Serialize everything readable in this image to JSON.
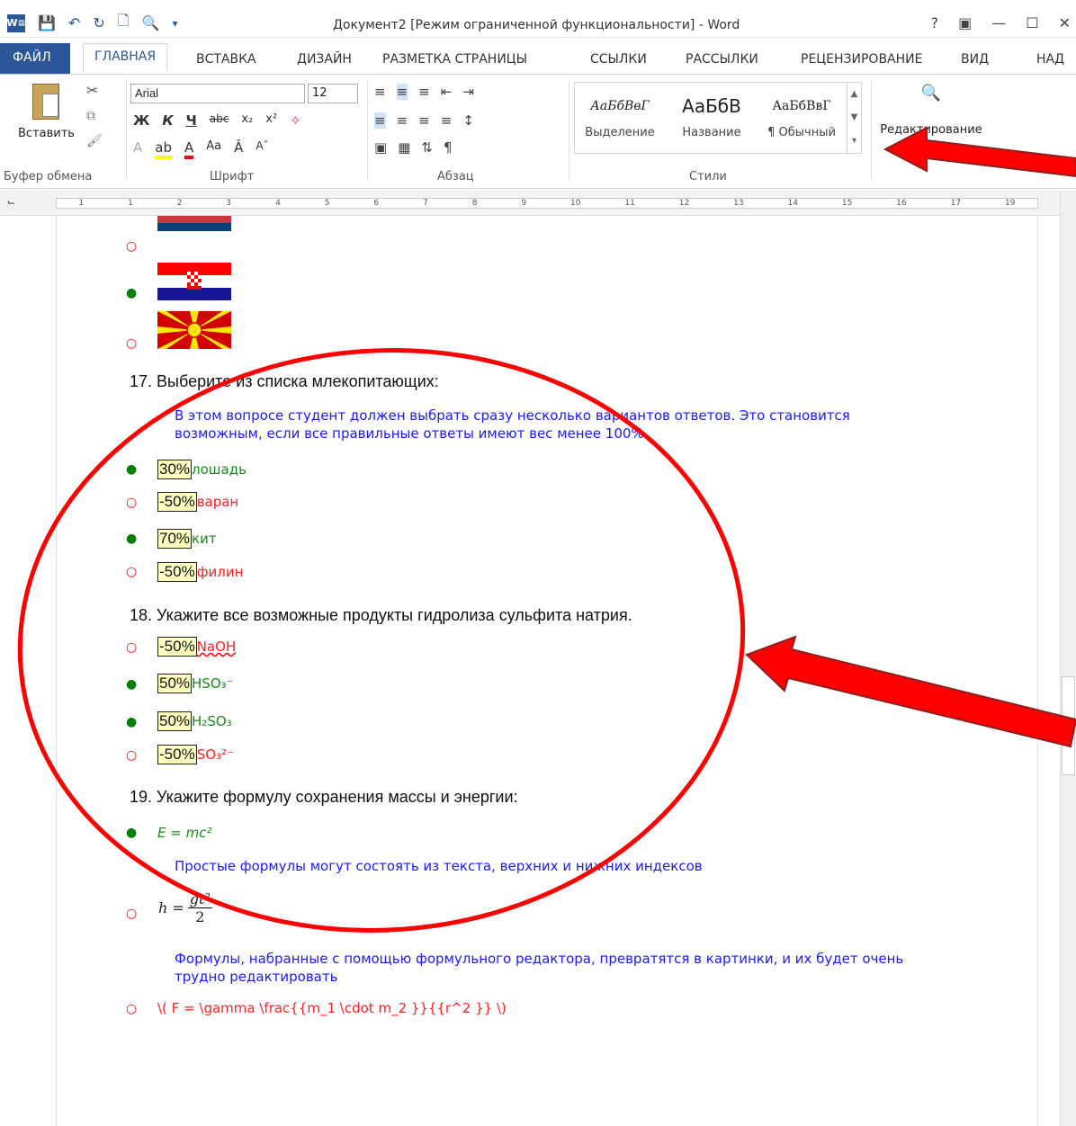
{
  "window": {
    "title": "Документ2 [Режим ограниченной функциональности] - Word",
    "help": "?",
    "minimize": "—",
    "maximize": "☐",
    "close": "✕",
    "word_logo": "W≡"
  },
  "tabs": {
    "file": "ФАЙЛ",
    "home": "ГЛАВНАЯ",
    "insert": "ВСТАВКА",
    "design": "ДИЗАЙН",
    "layout": "РАЗМЕТКА СТРАНИЦЫ",
    "references": "ССЫЛКИ",
    "mailings": "РАССЫЛКИ",
    "review": "РЕЦЕНЗИРОВАНИЕ",
    "view": "ВИД",
    "addins": "НАД"
  },
  "ribbon": {
    "paste_label": "Вставить",
    "clipboard_group": "Буфер обмена",
    "font_group": "Шрифт",
    "paragraph_group": "Абзац",
    "styles_group": "Стили",
    "font_name": "Arial",
    "font_size": "12",
    "styles": [
      {
        "preview": "АаБбВвГ",
        "name": "Выделение"
      },
      {
        "preview": "АаБбВ",
        "name": "Название"
      },
      {
        "preview": "АаБбВвГ",
        "name": "¶ Обычный"
      }
    ],
    "editing_label": "Редактирование"
  },
  "ruler": {
    "ticks": [
      "1",
      "1",
      "2",
      "3",
      "4",
      "5",
      "6",
      "7",
      "8",
      "9",
      "10",
      "11",
      "12",
      "13",
      "14",
      "15",
      "16",
      "17",
      "19"
    ]
  },
  "document": {
    "q17": {
      "question": "17. Выберите из списка млекопитающих:",
      "note": "В этом вопросе студент должен выбрать сразу несколько вариантов ответов. Это становится возможным, если все правильные ответы имеют вес менее 100%",
      "answers": [
        {
          "pct": "30%",
          "text": "лошадь"
        },
        {
          "pct": "-50%",
          "text": "варан"
        },
        {
          "pct": "70%",
          "text": "кит"
        },
        {
          "pct": "-50%",
          "text": "филин"
        }
      ]
    },
    "q18": {
      "question": "18. Укажите все возможные продукты гидролиза сульфита натрия.",
      "answers": [
        {
          "pct": "-50%",
          "text": "NaOH"
        },
        {
          "pct": "50%",
          "text": "HSO₃⁻"
        },
        {
          "pct": "50%",
          "text": "H₂SO₃"
        },
        {
          "pct": "-50%",
          "text": "SO₃²⁻"
        }
      ]
    },
    "q19": {
      "question": "19. Укажите формулу сохранения массы и энергии:",
      "answer1": "E = mc²",
      "note1": "Простые формулы могут состоять из текста, верхних и нижних индексов",
      "formula_h": "h =",
      "formula_num": "gt²",
      "formula_den": "2",
      "note2": "Формулы, набранные с помощью формульного редактора, превратятся в картинки, и их будет очень трудно редактировать",
      "answer3": "\\( F = \\gamma \\frac{{m_1  \\cdot m_2 }}{{r^2 }} \\)"
    }
  },
  "colors": {
    "accent": "#2b579a",
    "correct": "#1a8a1a",
    "wrong": "#ff2020",
    "note": "#1a1aff",
    "annotation": "#ff0000"
  }
}
